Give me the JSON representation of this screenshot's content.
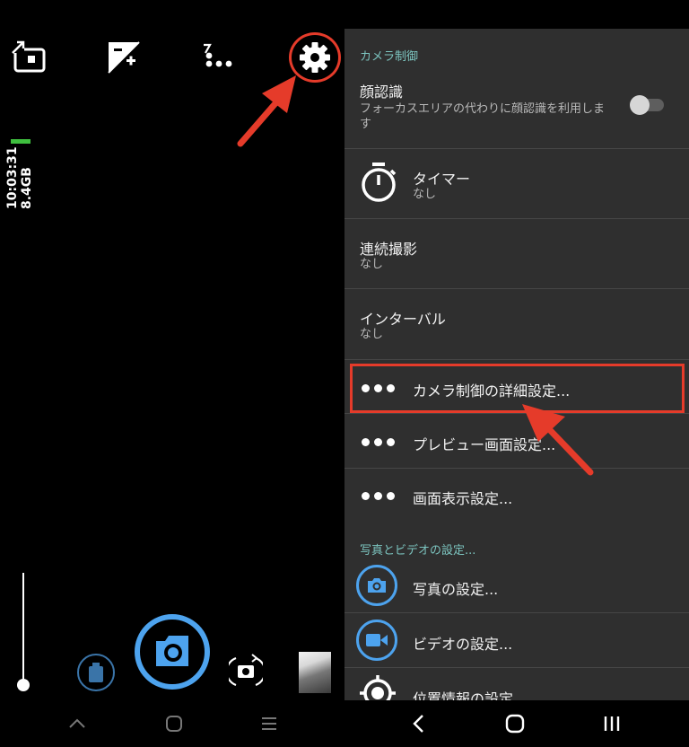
{
  "status": {
    "time": "10:03:31",
    "storage": "8.4GB"
  },
  "settings": {
    "section_camera": "カメラ制御",
    "face": {
      "title": "顔認識",
      "subtitle": "フォーカスエリアの代わりに顔認識を利用します",
      "toggle_on": false
    },
    "timer": {
      "title": "タイマー",
      "value": "なし"
    },
    "burst": {
      "title": "連続撮影",
      "value": "なし"
    },
    "interval": {
      "title": "インターバル",
      "value": "なし"
    },
    "advanced": "カメラ制御の詳細設定...",
    "preview": "プレビュー画面設定...",
    "display": "画面表示設定...",
    "section_photo_video": "写真とビデオの設定...",
    "photo": "写真の設定...",
    "video": "ビデオの設定...",
    "location": "位置情報の設定..."
  },
  "icons": {
    "top_bar": [
      "pip-toggle-icon",
      "exposure-lock-icon",
      "more-dots-icon",
      "gear-icon"
    ],
    "nav_left": [
      "chevron-up-icon",
      "home-icon",
      "menu-icon"
    ],
    "nav_right": [
      "back-icon",
      "home-icon",
      "recents-icon"
    ]
  },
  "colors": {
    "accent": "#4da3ee",
    "section_header": "#7cc4bf",
    "panel_bg": "#2f2f2f",
    "annotation": "#e53b2a",
    "battery": "#3fbf3f"
  }
}
